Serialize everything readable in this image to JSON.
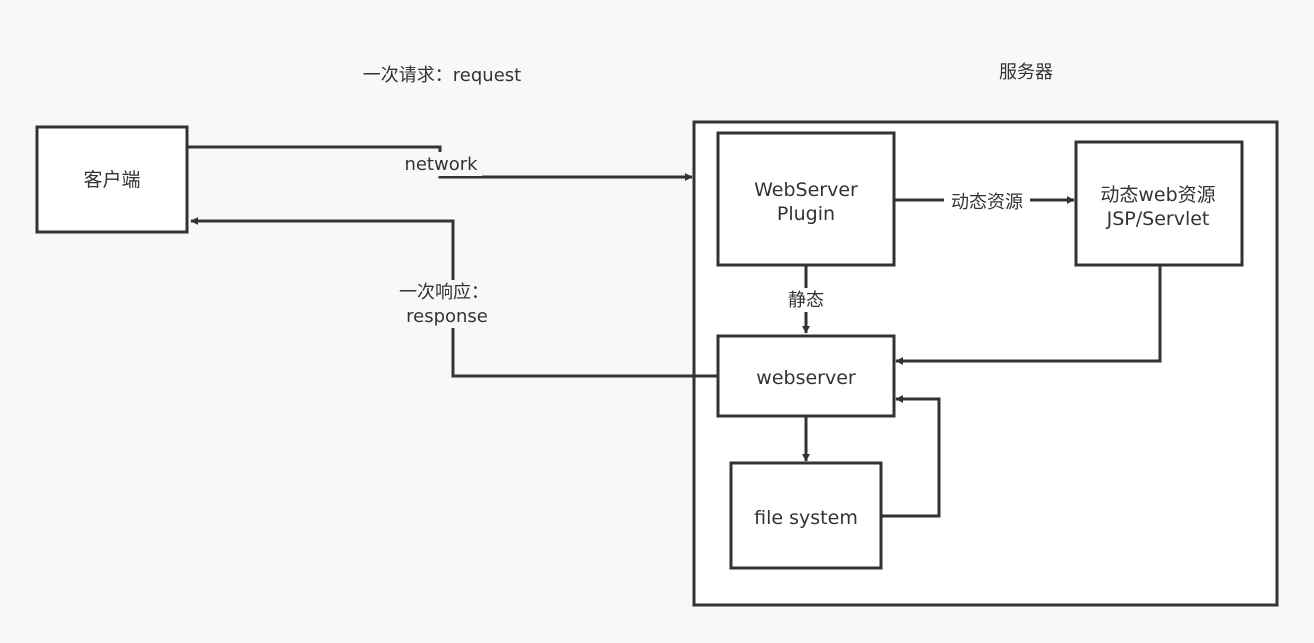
{
  "diagram": {
    "labels": {
      "request": "一次请求：request",
      "server_title": "服务器",
      "network": "network",
      "response_line1": "一次响应：",
      "response_line2": "response",
      "dynamic_edge": "动态资源",
      "static_edge": "静态"
    },
    "nodes": {
      "client": "客户端",
      "plugin_line1": "WebServer",
      "plugin_line2": "Plugin",
      "dynamic_line1": "动态web资源",
      "dynamic_line2": "JSP/Servlet",
      "webserver": "webserver",
      "filesystem": "file system"
    },
    "colors": {
      "stroke": "#333333",
      "fill": "#ffffff",
      "background": "#f8f8f8",
      "text": "#333333"
    }
  }
}
